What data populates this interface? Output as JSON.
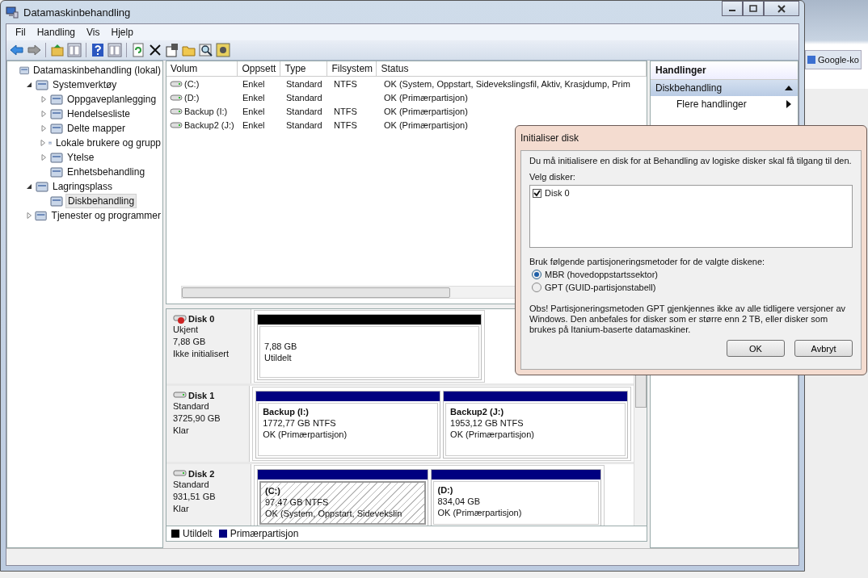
{
  "window": {
    "title": "Datamaskinbehandling"
  },
  "background": {
    "tab": "Google-ko"
  },
  "menu": [
    "Fil",
    "Handling",
    "Vis",
    "Hjelp"
  ],
  "tree": [
    {
      "label": "Datamaskinbehandling (lokal)",
      "selected": false,
      "children": [
        {
          "label": "Systemverktøy",
          "expanded": true,
          "selected": false,
          "children": [
            {
              "label": "Oppgaveplanlegging",
              "expanded": false,
              "selected": false
            },
            {
              "label": "Hendelsesliste",
              "expanded": false,
              "selected": false
            },
            {
              "label": "Delte mapper",
              "expanded": false,
              "selected": false
            },
            {
              "label": "Lokale brukere og grupp",
              "expanded": false,
              "selected": false
            },
            {
              "label": "Ytelse",
              "expanded": false,
              "selected": false
            },
            {
              "label": "Enhetsbehandling",
              "selected": false
            }
          ]
        },
        {
          "label": "Lagringsplass",
          "expanded": true,
          "selected": false,
          "children": [
            {
              "label": "Diskbehandling",
              "selected": true
            }
          ]
        },
        {
          "label": "Tjenester og programmer",
          "expanded": false,
          "selected": false
        }
      ]
    }
  ],
  "table": {
    "columns": [
      "Volum",
      "Oppsett",
      "Type",
      "Filsystem",
      "Status"
    ],
    "rows": [
      {
        "volume": "(C:)",
        "layout": "Enkel",
        "type": "Standard",
        "filesystem": "NTFS",
        "status": "OK (System, Oppstart, Sidevekslingsfil, Aktiv, Krasjdump, Prim"
      },
      {
        "volume": "(D:)",
        "layout": "Enkel",
        "type": "Standard",
        "status": "OK (Primærpartisjon)"
      },
      {
        "volume": "Backup (I:)",
        "layout": "Enkel",
        "type": "Standard",
        "filesystem": "NTFS",
        "status": "OK (Primærpartisjon)"
      },
      {
        "volume": "Backup2 (J:)",
        "layout": "Enkel",
        "type": "Standard",
        "filesystem": "NTFS",
        "status": "OK (Primærpartisjon)"
      }
    ]
  },
  "disks": [
    {
      "name": "Disk 0",
      "kind": "uninitialized",
      "info": [
        "Ukjent",
        "7,88 GB",
        "Ikke initialisert"
      ],
      "partitions": [
        {
          "lines": [
            "7,88 GB",
            "Utildelt"
          ],
          "kind": "unallocated",
          "selected": false
        }
      ]
    },
    {
      "name": "Disk 1",
      "kind": "basic",
      "info": [
        "Standard",
        "3725,90 GB",
        "Klar"
      ],
      "partitions": [
        {
          "title": "Backup  (I:)",
          "lines": [
            "1772,77 GB NTFS",
            "OK (Primærpartisjon)"
          ],
          "kind": "primary",
          "selected": false
        },
        {
          "title": "Backup2  (J:)",
          "lines": [
            "1953,12 GB NTFS",
            "OK (Primærpartisjon)"
          ],
          "kind": "primary",
          "selected": false
        }
      ]
    },
    {
      "name": "Disk 2",
      "kind": "basic",
      "info": [
        "Standard",
        "931,51 GB",
        "Klar"
      ],
      "partitions": [
        {
          "title": "(C:)",
          "lines": [
            "97,47 GB NTFS",
            "OK (System, Oppstart, Sidevekslin"
          ],
          "kind": "primary",
          "selected": true
        },
        {
          "title": "(D:)",
          "lines": [
            "834,04 GB",
            "OK (Primærpartisjon)"
          ],
          "kind": "primary",
          "selected": false
        }
      ]
    }
  ],
  "legend": [
    {
      "label": "Utildelt",
      "color": "#000000"
    },
    {
      "label": "Primærpartisjon",
      "color": "#000080"
    }
  ],
  "actions": {
    "title": "Handlinger",
    "items": [
      {
        "label": "Diskbehandling",
        "kind": "section"
      },
      {
        "label": "Flere handlinger",
        "kind": "submenu"
      }
    ]
  },
  "dialog": {
    "title": "Initialiser disk",
    "message": "Du må initialisere en disk for at Behandling av logiske disker skal få tilgang til den.",
    "list_label": "Velg disker:",
    "disks": [
      {
        "label": "Disk 0",
        "checked": true
      }
    ],
    "method_label": "Bruk følgende partisjoneringsmetoder for de valgte diskene:",
    "options": [
      {
        "label": "MBR (hovedoppstartssektor)",
        "selected": true
      },
      {
        "label": "GPT (GUID-partisjonstabell)",
        "selected": false
      }
    ],
    "note": "Obs!  Partisjoneringsmetoden GPT gjenkjennes ikke av alle tidligere versjoner av Windows. Den anbefales for disker som er større enn 2 TB, eller disker som brukes på Itanium-baserte datamaskiner.",
    "buttons": [
      "OK",
      "Avbryt"
    ]
  }
}
